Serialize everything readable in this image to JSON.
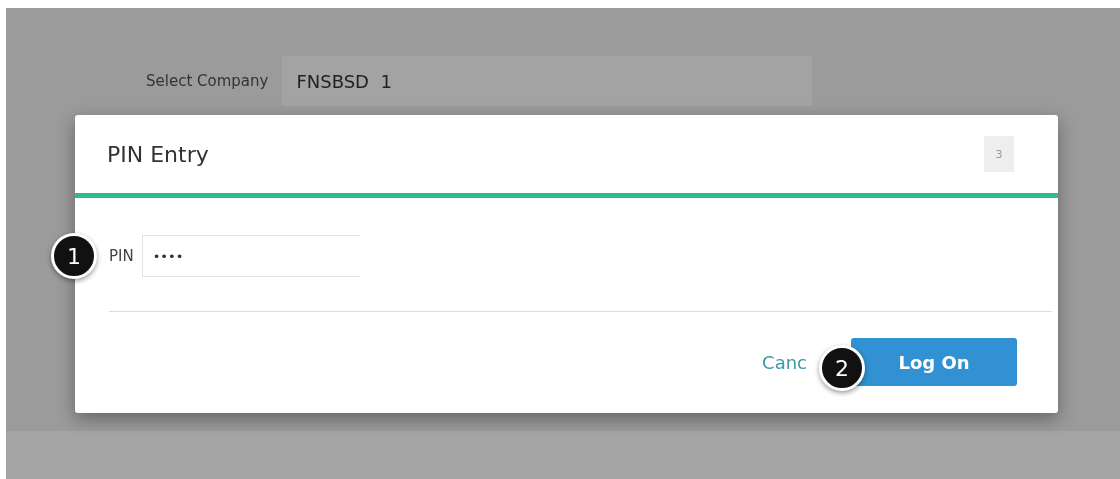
{
  "background": {
    "company_label": "Select Company",
    "company_value": "FNSBSD  1"
  },
  "dialog": {
    "title": "PIN Entry",
    "close_label": "3",
    "pin": {
      "label": "PIN",
      "value": "••••"
    },
    "buttons": [
      {
        "kind": "link",
        "label": "Canc"
      },
      {
        "kind": "primary",
        "label": "Log On"
      }
    ]
  },
  "callouts": [
    "1",
    "2"
  ]
}
